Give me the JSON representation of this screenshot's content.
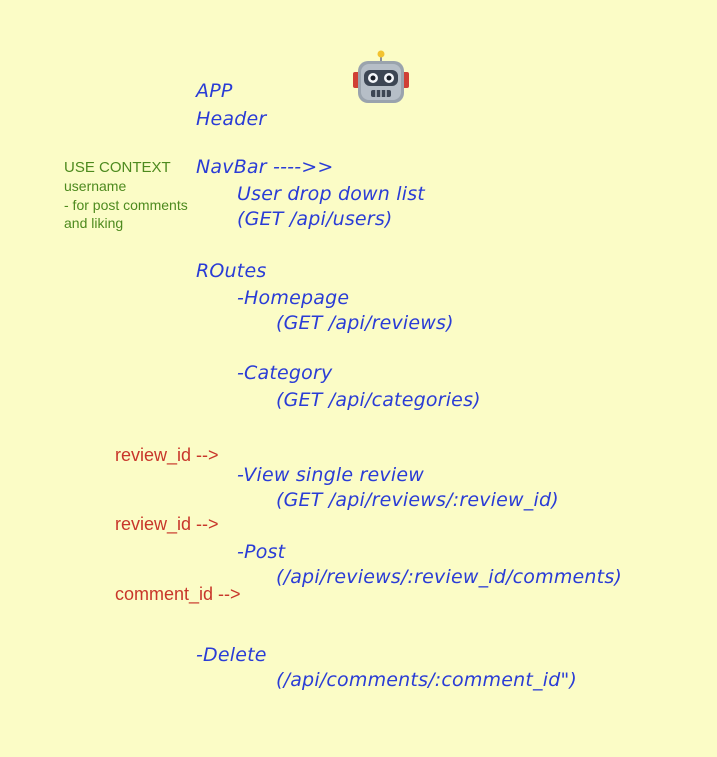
{
  "tree": {
    "app": "APP",
    "header": "Header",
    "navbar": "NavBar ---->>",
    "user_dropdown": "User drop down list",
    "users_endpoint": "(GET /api/users)",
    "routes": "ROutes",
    "homepage": "-Homepage",
    "homepage_endpoint": "(GET /api/reviews)",
    "category": "-Category",
    "category_endpoint": "(GET /api/categories)",
    "view_review": "-View single review",
    "view_review_endpoint": "(GET /api/reviews/:review_id)",
    "post": "-Post",
    "post_endpoint": "(/api/reviews/:review_id/comments)",
    "delete": "-Delete",
    "delete_endpoint": "(/api/comments/:comment_id\")"
  },
  "context_note": {
    "title": "USE CONTEXT",
    "line1": "username",
    "line2": "- for post comments",
    "line3": "and liking"
  },
  "params": {
    "review_id_1": "review_id -->",
    "review_id_2": "review_id -->",
    "comment_id": "comment_id -->"
  },
  "colors": {
    "background": "#fbfcc6",
    "tree_text": "#2a3cd6",
    "context_text": "#4d8a1e",
    "param_text": "#c8362a"
  },
  "icons": {
    "mascot": "robot-icon"
  }
}
